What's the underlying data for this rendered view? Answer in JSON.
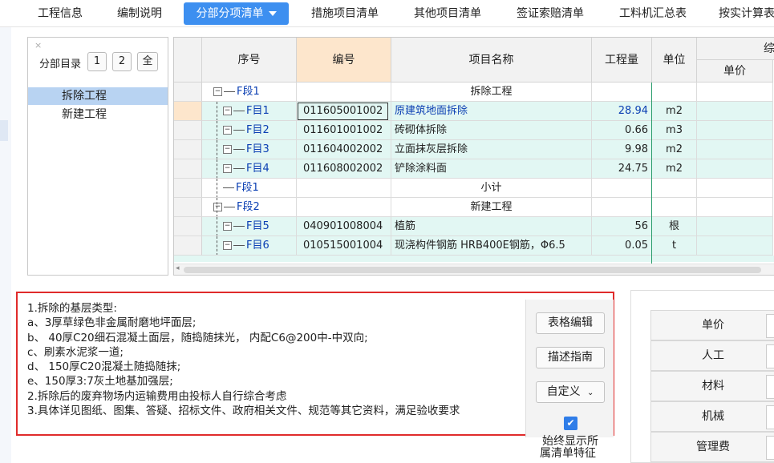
{
  "tabs": [
    {
      "label": "工程信息"
    },
    {
      "label": "编制说明"
    },
    {
      "label": "分部分项清单"
    },
    {
      "label": "措施项目清单"
    },
    {
      "label": "其他项目清单"
    },
    {
      "label": "签证索赔清单"
    },
    {
      "label": "工料机汇总表"
    },
    {
      "label": "按实计算表"
    }
  ],
  "nav": {
    "close": "×",
    "label": "分部目录",
    "buttons": [
      "1",
      "2",
      "全"
    ],
    "items": [
      {
        "label": "拆除工程",
        "selected": true
      },
      {
        "label": "新建工程",
        "selected": false
      }
    ]
  },
  "grid": {
    "headers": {
      "seq": "序号",
      "code": "编号",
      "name": "项目名称",
      "qty": "工程量",
      "unit": "单位",
      "composite": "综",
      "unit_price": "单价"
    },
    "rows": [
      {
        "seq": "F段1",
        "code": "",
        "name": "拆除工程",
        "qty": "",
        "unit": "",
        "kind": "section"
      },
      {
        "seq": "F目1",
        "code": "011605001002",
        "name": "原建筑地面拆除",
        "qty": "28.94",
        "unit": "m2",
        "kind": "item"
      },
      {
        "seq": "F目2",
        "code": "011601001002",
        "name": "砖砌体拆除",
        "qty": "0.66",
        "unit": "m3",
        "kind": "item"
      },
      {
        "seq": "F目3",
        "code": "011604002002",
        "name": "立面抹灰层拆除",
        "qty": "9.98",
        "unit": "m2",
        "kind": "item"
      },
      {
        "seq": "F目4",
        "code": "011608002002",
        "name": "铲除涂料面",
        "qty": "24.75",
        "unit": "m2",
        "kind": "item"
      },
      {
        "seq": "F段1",
        "code": "",
        "name": "小计",
        "qty": "",
        "unit": "",
        "kind": "subtotal"
      },
      {
        "seq": "F段2",
        "code": "",
        "name": "新建工程",
        "qty": "",
        "unit": "",
        "kind": "section"
      },
      {
        "seq": "F目5",
        "code": "040901008004",
        "name": "植筋",
        "qty": "56",
        "unit": "根",
        "kind": "item"
      },
      {
        "seq": "F目6",
        "code": "010515001004",
        "name": "现浇构件钢筋 HRB400E钢筋，Φ6.5",
        "qty": "0.05",
        "unit": "t",
        "kind": "item"
      }
    ]
  },
  "description": {
    "lines": [
      "1.拆除的基层类型:",
      "a、3厚草绿色非金属耐磨地坪面层;",
      "b、  40厚C20细石混凝土面层，随捣随抹光， 内配C6@200中-中双向;",
      "c、刷素水泥浆一道;",
      "d、  150厚C20混凝土随捣随抹;",
      "e、150厚3:7灰土地基加强层;",
      "2.拆除后的废弃物场内运输费用由投标人自行综合考虑",
      "3.具体详见图纸、图集、答疑、招标文件、政府相关文件、规范等其它资料，满足验收要求"
    ],
    "buttons": {
      "table_edit": "表格编辑",
      "guide": "描述指南",
      "custom": "自定义"
    },
    "checkbox_checked": true,
    "checkbox_caption_1": "始终显示所",
    "checkbox_caption_2": "属清单特征"
  },
  "right_panel": {
    "items": [
      "单价",
      "人工",
      "材料",
      "机械",
      "管理费"
    ]
  },
  "colors": {
    "accent": "#3d8ff0",
    "highlight_row": "#e2f7f3",
    "selected_nav": "#b8d3f2",
    "header_orange": "#fde6cc",
    "red_frame": "#e02b2b",
    "tree_blue": "#0b3fb3"
  }
}
